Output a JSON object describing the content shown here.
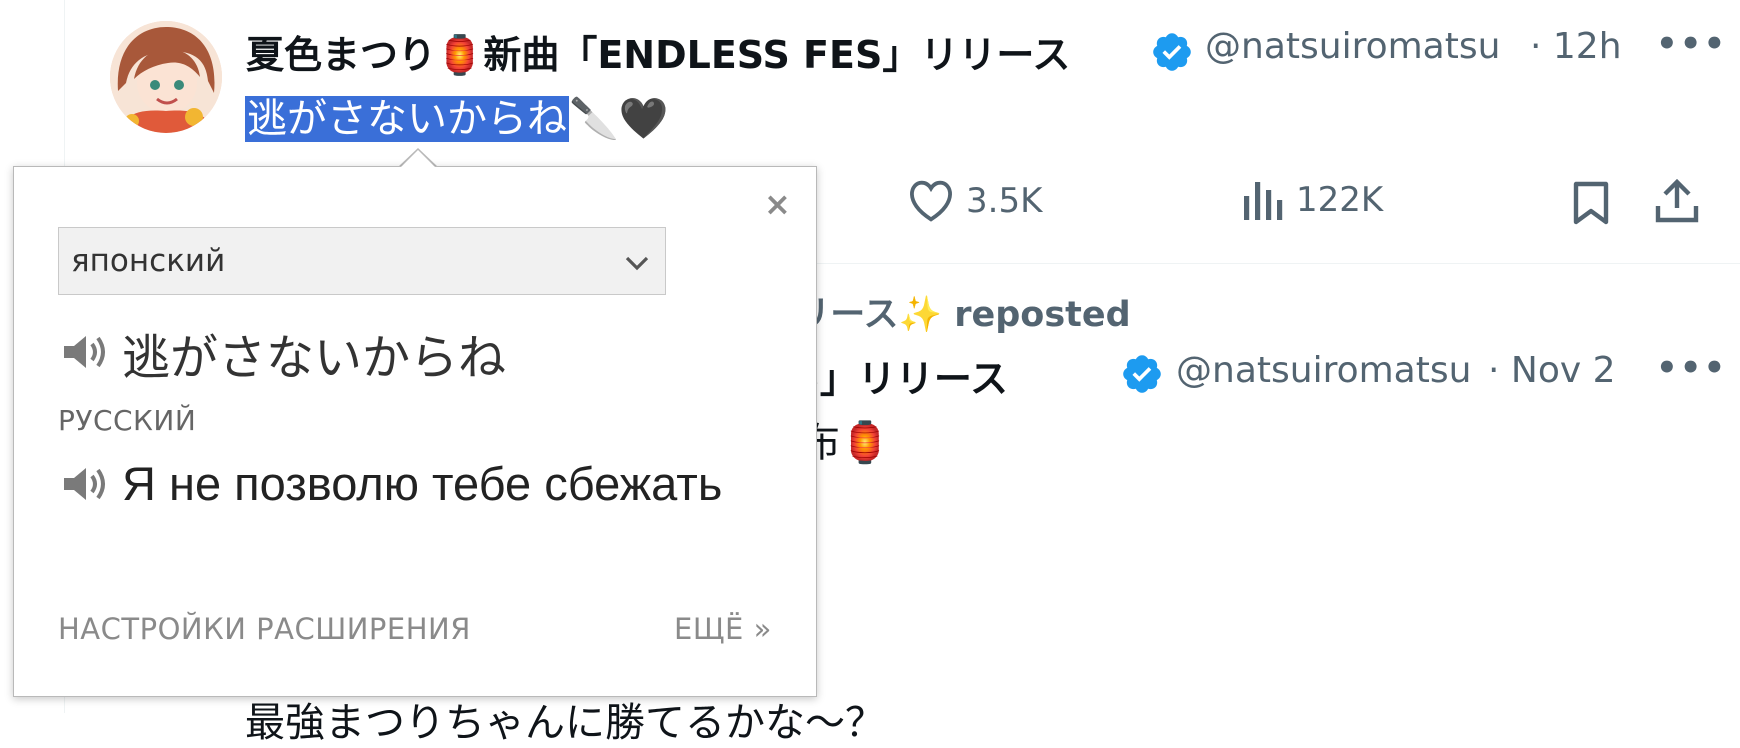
{
  "tweet1": {
    "author_name": "夏色まつり🏮新曲「ENDLESS FES」リリース",
    "handle": "@natsuiromatsu",
    "time": "· 12h",
    "text_selected": "逃がさないからね",
    "text_rest": "🔪🖤",
    "likes": "3.5K",
    "views": "122K"
  },
  "repost": {
    "label_visible": "S」リリース✨",
    "label_suffix": "reposted"
  },
  "tweet2": {
    "author_visible": "S FES」リリース",
    "handle": "@natsuiromatsu",
    "time": "· Nov 2",
    "text_fragment": "布🏮",
    "text_bottom": "最強まつりちゃんに勝てるかな〜？"
  },
  "translate_popup": {
    "close": "×",
    "source_language": "японский",
    "source_text": "逃がさないからね",
    "target_language": "РУССКИЙ",
    "target_text": "Я не позволю тебе сбежать",
    "settings_link": "НАСТРОЙКИ РАСШИРЕНИЯ",
    "more_link": "ЕЩЁ »"
  },
  "colors": {
    "selection": "#3a6fd8",
    "verified": "#1d9bf0",
    "muted": "#536471"
  },
  "icons": [
    "verified-badge-icon",
    "more-icon",
    "heart-icon",
    "views-icon",
    "bookmark-icon",
    "share-icon",
    "speaker-icon",
    "chevron-down-icon",
    "close-icon"
  ]
}
